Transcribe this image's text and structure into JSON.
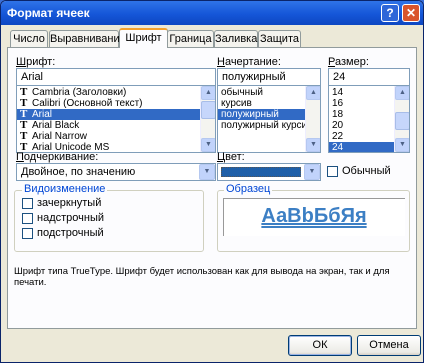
{
  "window": {
    "title": "Формат ячеек",
    "help_glyph": "?",
    "close_glyph": "✕"
  },
  "tabs": [
    {
      "label": "Число"
    },
    {
      "label": "Выравнивание"
    },
    {
      "label": "Шрифт",
      "active": true
    },
    {
      "label": "Граница"
    },
    {
      "label": "Заливка"
    },
    {
      "label": "Защита"
    }
  ],
  "font": {
    "label_prefix": "Ш",
    "label_rest": "рифт:",
    "value": "Arial",
    "items": [
      {
        "name": "Cambria (Заголовки)",
        "icon": "truetype-icon"
      },
      {
        "name": "Calibri (Основной текст)",
        "icon": "truetype-icon"
      },
      {
        "name": "Arial",
        "icon": "truetype-icon",
        "selected": true
      },
      {
        "name": "Arial Black",
        "icon": "truetype-icon"
      },
      {
        "name": "Arial Narrow",
        "icon": "truetype-icon"
      },
      {
        "name": "Arial Unicode MS",
        "icon": "truetype-icon"
      }
    ]
  },
  "style": {
    "label_prefix": "Н",
    "label_rest": "ачертание:",
    "value": "полужирный",
    "items": [
      {
        "name": "обычный"
      },
      {
        "name": "курсив"
      },
      {
        "name": "полужирный",
        "selected": true
      },
      {
        "name": "полужирный курсив"
      }
    ]
  },
  "size": {
    "label_prefix": "Р",
    "label_rest": "азмер:",
    "value": "24",
    "items": [
      {
        "name": "14"
      },
      {
        "name": "16"
      },
      {
        "name": "18"
      },
      {
        "name": "20"
      },
      {
        "name": "22"
      },
      {
        "name": "24",
        "selected": true
      }
    ]
  },
  "underline": {
    "label_prefix": "П",
    "label_rest": "одчеркивание:",
    "value": "Двойное, по значению"
  },
  "color": {
    "label_prefix": "Ц",
    "label_rest": "вет:",
    "swatch": "#1f5fa8",
    "normal_label": "Обычный"
  },
  "effects": {
    "title": "Видоизменение",
    "items": [
      {
        "label": "зачеркнутый"
      },
      {
        "label": "надстрочный"
      },
      {
        "label": "подстрочный"
      }
    ]
  },
  "sample": {
    "title": "Образец",
    "text": "АаВbБбЯя",
    "color": "#3c7fc4"
  },
  "description": "Шрифт типа TrueType. Шрифт будет использован как для вывода на экран, так и для печати.",
  "buttons": {
    "ok": "ОК",
    "cancel": "Отмена"
  },
  "icons": {
    "scroll_up": "▲",
    "scroll_down": "▼",
    "dropdown": "▼",
    "truetype": "T"
  }
}
